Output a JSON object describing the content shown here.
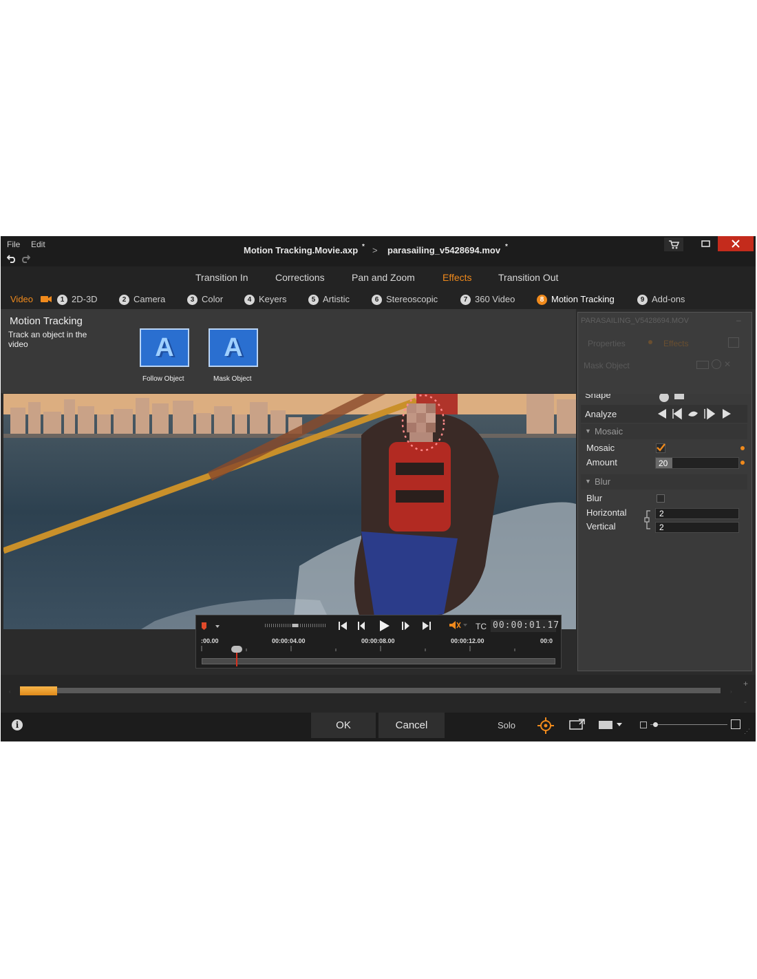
{
  "menu": {
    "file": "File",
    "edit": "Edit"
  },
  "title": {
    "project": "Motion Tracking.Movie.axp",
    "project_mark": "*",
    "separator": ">",
    "clip": "parasailing_v5428694.mov",
    "clip_mark": "*"
  },
  "top_tabs": [
    "Transition In",
    "Corrections",
    "Pan and Zoom",
    "Effects",
    "Transition Out"
  ],
  "active_top_tab": "Effects",
  "sub_nav": {
    "video_label": "Video",
    "items": [
      {
        "num": "1",
        "label": "2D-3D"
      },
      {
        "num": "2",
        "label": "Camera"
      },
      {
        "num": "3",
        "label": "Color"
      },
      {
        "num": "4",
        "label": "Keyers"
      },
      {
        "num": "5",
        "label": "Artistic"
      },
      {
        "num": "6",
        "label": "Stereoscopic"
      },
      {
        "num": "7",
        "label": "360 Video"
      },
      {
        "num": "8",
        "label": "Motion Tracking"
      },
      {
        "num": "9",
        "label": "Add-ons"
      }
    ]
  },
  "effect_panel": {
    "title": "Motion Tracking",
    "description": "Track an object in the video",
    "presets": [
      {
        "label": "Follow Object",
        "glyph": "A"
      },
      {
        "label": "Mask Object",
        "glyph": "A"
      }
    ]
  },
  "properties": {
    "header": "PARASAILING_V5428694.MOV",
    "tabs": [
      "Properties",
      "Effects"
    ],
    "section": "Mask Object",
    "shape_label": "Shape",
    "analyze_label": "Analyze",
    "mosaic_group": "Mosaic",
    "mosaic_label": "Mosaic",
    "mosaic_checked": true,
    "amount_label": "Amount",
    "amount_value": "20",
    "blur_group": "Blur",
    "blur_label": "Blur",
    "blur_checked": false,
    "horizontal_label": "Horizontal",
    "horizontal_value": "2",
    "vertical_label": "Vertical",
    "vertical_value": "2"
  },
  "transport": {
    "tc_label": "TC",
    "timecode": "00:00:01.17",
    "ruler": [
      ":00.00",
      "00:00:04.00",
      "00:00:08.00",
      "00:00:12.00",
      "00:0"
    ]
  },
  "bottom": {
    "ok": "OK",
    "cancel": "Cancel",
    "solo": "Solo"
  },
  "colors": {
    "accent": "#f08a1c",
    "bg": "#2b2b2b",
    "titlebar": "#1c1c1c",
    "close": "#c42b1c"
  }
}
